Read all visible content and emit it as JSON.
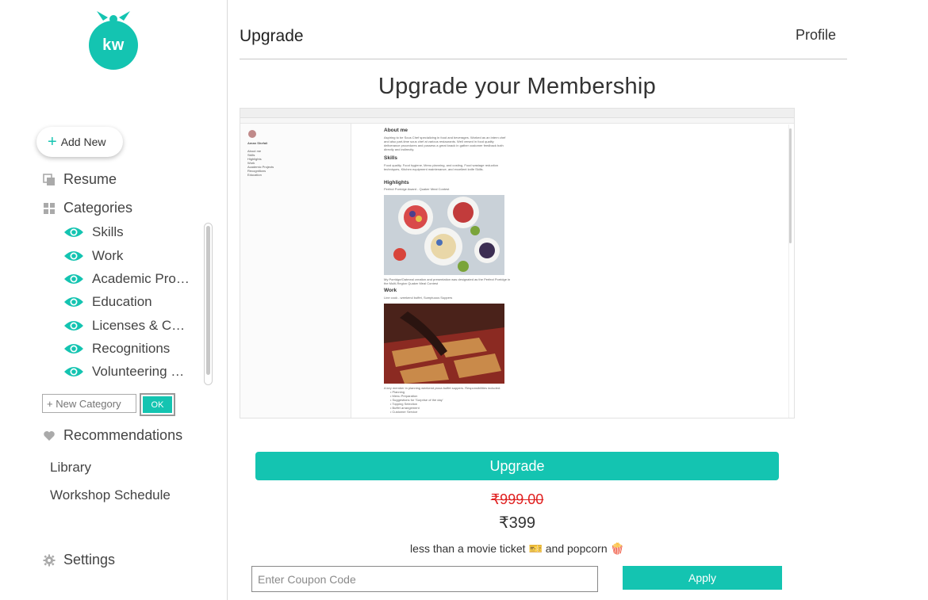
{
  "brand": {
    "logo_text": "kw",
    "accent_color": "#14c4b1"
  },
  "sidebar": {
    "add_new_label": "Add New",
    "resume_label": "Resume",
    "categories_label": "Categories",
    "categories": [
      {
        "label": "Skills",
        "icon": "eye-icon"
      },
      {
        "label": "Work",
        "icon": "eye-icon"
      },
      {
        "label": "Academic Projects",
        "icon": "eye-icon"
      },
      {
        "label": "Education",
        "icon": "eye-icon"
      },
      {
        "label": "Licenses & Certifications",
        "icon": "eye-icon"
      },
      {
        "label": "Recognitions",
        "icon": "eye-icon"
      },
      {
        "label": "Volunteering Experience",
        "icon": "eye-icon"
      }
    ],
    "new_category_placeholder": "+ New Category",
    "ok_label": "OK",
    "recommendations_label": "Recommendations",
    "library_label": "Library",
    "workshop_label": "Workshop Schedule",
    "settings_label": "Settings"
  },
  "header": {
    "title": "Upgrade",
    "profile_label": "Profile"
  },
  "main": {
    "headline": "Upgrade your Membership",
    "preview": {
      "profile_name": "Aman Shefali",
      "side_links": [
        "About me",
        "Skills",
        "Highlights",
        "Work",
        "Academic Projects",
        "Recognitions",
        "Education"
      ],
      "about_heading": "About me",
      "about_text": "Aspiring to be Sous Chef specializing in food and beverages. Worked as an intern chef and also part-time sous chef at various restaurants. Well versed in food quality deliverance procedures and possess a great knack in gather customer feedback both directly and indirectly.",
      "skills_heading": "Skills",
      "skills_text": "Food quality, Food hygiene, Menu planning, and costing, Food wastage reduction techniques, Kitchen equipment maintenance, and excellent knife Skills.",
      "highlights_heading": "Highlights",
      "highlight_title": "Perfect Porridge Award - Quaker Meal Contest",
      "highlight_caption": "My Porridge/Oatmeal creation and presentation was designated as the Perfect Porridge in the Multi-Region Quaker Meal Contest",
      "work_heading": "Work",
      "work_title": "Line cook - weekend buffet, Sumptuous Suppers",
      "work_caption": "A key member in planning weekend pizza buffet suppers. Responsibilities included:",
      "work_bullets": [
        "Planning",
        "Menu Preparation",
        "Suggestions for 'Surprise of the day'",
        "Topping Selection",
        "Buffet arrangement",
        "Customer Service"
      ]
    },
    "upgrade_label": "Upgrade",
    "old_price": "₹999.00",
    "new_price": "₹399",
    "tagline": "less than a movie ticket 🎫 and popcorn 🍿",
    "coupon_placeholder": "Enter Coupon Code",
    "apply_label": "Apply"
  }
}
